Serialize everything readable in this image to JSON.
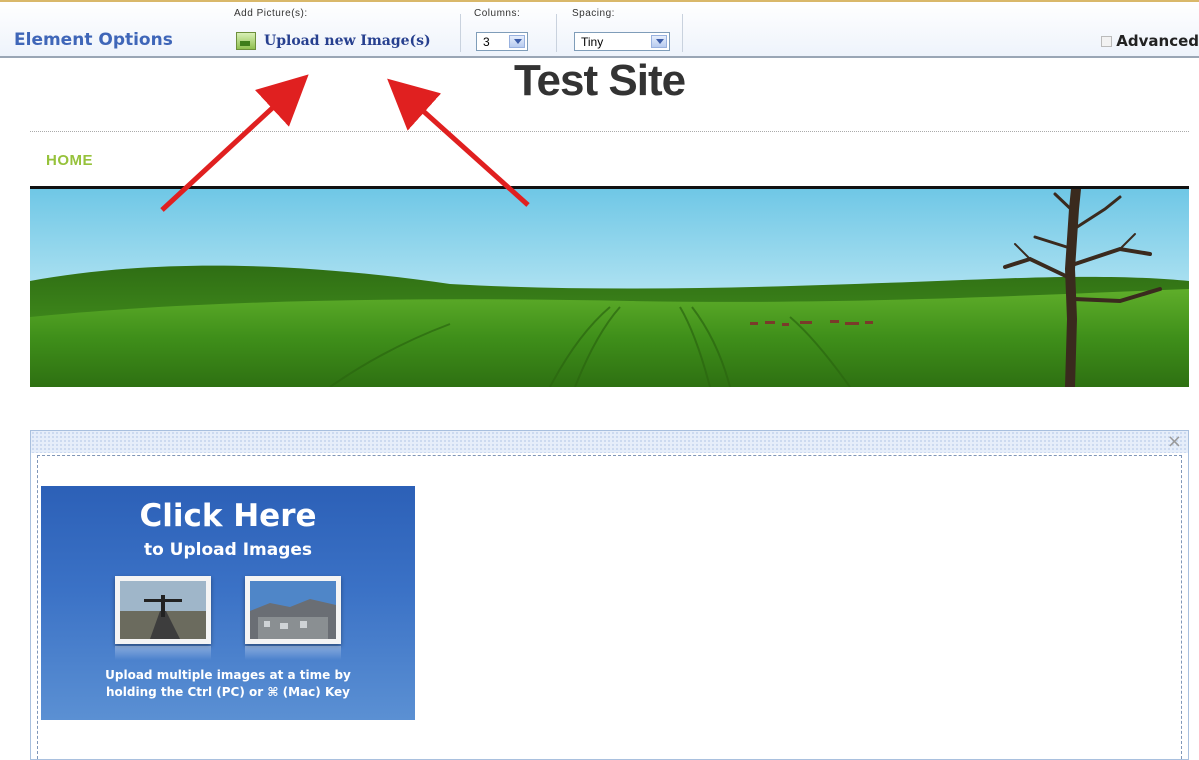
{
  "toolbar": {
    "title": "Element Options",
    "add_picture_label": "Add Picture(s):",
    "upload_link": "Upload new Image(s)",
    "columns_label": "Columns:",
    "columns_value": "3",
    "spacing_label": "Spacing:",
    "spacing_value": "Tiny",
    "advanced_label": "Advanced"
  },
  "site": {
    "title": "Test Site",
    "nav": [
      "HOME"
    ]
  },
  "upload_card": {
    "heading": "Click Here",
    "subheading": "to Upload Images",
    "hint_line1": "Upload multiple images at a time by",
    "hint_line2": "holding the Ctrl (PC) or ⌘ (Mac) Key"
  },
  "block": {
    "close_label": "×"
  },
  "colors": {
    "toolbar_title": "#3f66b8",
    "upload_link": "#27408f",
    "nav_home": "#96c23b",
    "card_blue": "#2c60b7",
    "annotation_arrow": "#e02020"
  },
  "icons": [
    "upload-image-icon",
    "select-arrow-icon",
    "advanced-icon",
    "close-icon"
  ]
}
